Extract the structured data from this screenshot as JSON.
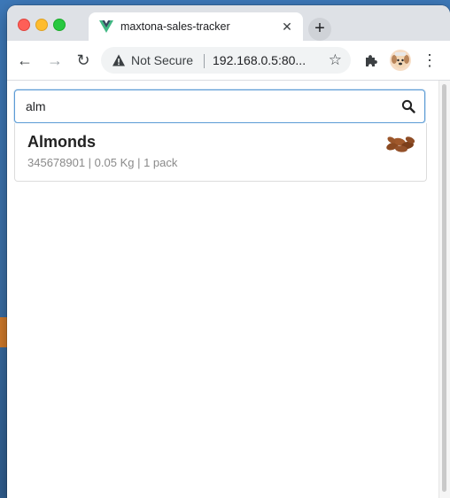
{
  "browser": {
    "tab_title": "maxtona-sales-tracker",
    "tab_close": "✕",
    "new_tab": "+",
    "security_label": "Not Secure",
    "url": "192.168.0.5:80...",
    "star": "☆",
    "back": "←",
    "forward": "→",
    "reload": "↻",
    "menu": "⋮"
  },
  "search": {
    "value": "alm",
    "placeholder": ""
  },
  "results": [
    {
      "name": "Almonds",
      "meta": "345678901 | 0.05 Kg | 1 pack",
      "icon": "almonds-image"
    }
  ],
  "colors": {
    "accent": "#5b9bd5",
    "vue_green": "#41b883",
    "vue_dark": "#35495e"
  }
}
